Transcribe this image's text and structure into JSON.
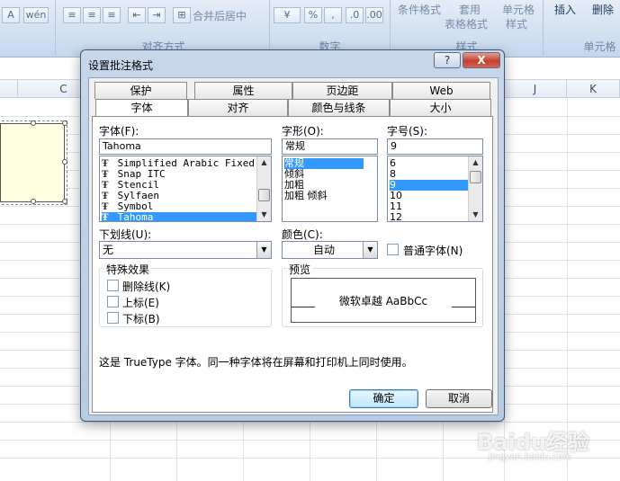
{
  "ribbon": {
    "group_labels": [
      "对齐方式",
      "数字",
      "样式",
      "单元格"
    ],
    "wrap_label": "合并后居中",
    "percent_label": "%",
    "comma_label": ",",
    "cond_format_label": "条件格式",
    "table_format_label": "表格格式",
    "apply_label": "套用",
    "cell_style_label_1": "单元格",
    "cell_style_label_2": "样式",
    "insert_label": "插入",
    "delete_label": "删除"
  },
  "sheet": {
    "columns": [
      "C",
      "J",
      "K"
    ]
  },
  "dialog": {
    "title": "设置批注格式",
    "help_label": "?",
    "close_label": "X",
    "tabs_top": [
      "保护",
      "属性",
      "页边距",
      "Web"
    ],
    "tabs_bottom": [
      "字体",
      "对齐",
      "颜色与线条",
      "大小"
    ],
    "active_tab": "字体",
    "font_label": "字体(F):",
    "font_value": "Tahoma",
    "font_list": [
      "Simplified Arabic Fixed",
      "Snap ITC",
      "Stencil",
      "Sylfaen",
      "Symbol",
      "Tahoma"
    ],
    "font_selected": "Tahoma",
    "style_label": "字形(O):",
    "style_value": "常规",
    "style_list": [
      "常规",
      "倾斜",
      "加粗",
      "加粗 倾斜"
    ],
    "style_selected": "常规",
    "size_label": "字号(S):",
    "size_value": "9",
    "size_list": [
      "6",
      "8",
      "9",
      "10",
      "11",
      "12"
    ],
    "size_selected": "9",
    "underline_label": "下划线(U):",
    "underline_value": "无",
    "color_label": "颜色(C):",
    "color_value": "自动",
    "normal_font_label": "普通字体(N)",
    "effects_label": "特殊效果",
    "effects": [
      "删除线(K)",
      "上标(E)",
      "下标(B)"
    ],
    "preview_label": "预览",
    "preview_text": "微软卓越  AaBbCc",
    "info_text": "这是 TrueType 字体。同一种字体将在屏幕和打印机上同时使用。",
    "ok_label": "确定",
    "cancel_label": "取消"
  },
  "watermark": {
    "main": "Baidu经验",
    "sub": "jingyan.baidu.com"
  }
}
